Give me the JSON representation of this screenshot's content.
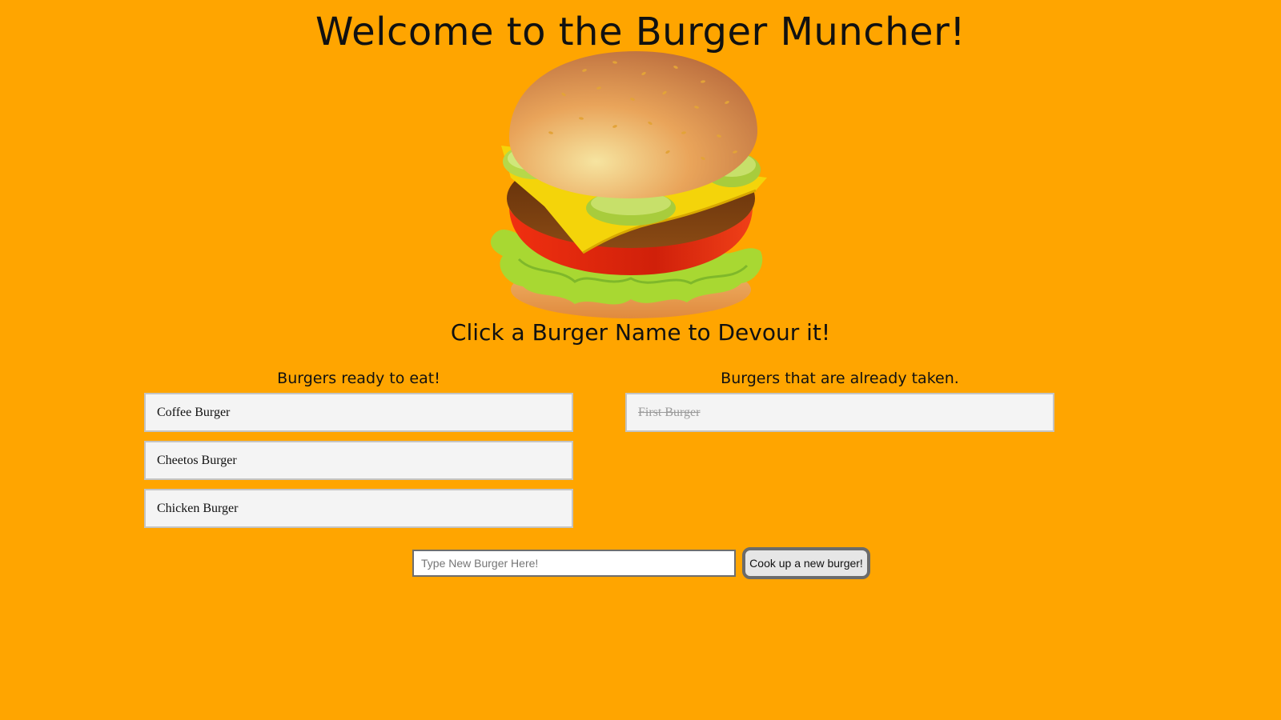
{
  "page": {
    "title": "Welcome to the Burger Muncher!",
    "subtitle": "Click a Burger Name to Devour it!",
    "background_color": "#FFA500"
  },
  "hero": {
    "image": "burger-illustration"
  },
  "ready_column": {
    "heading": "Burgers ready to eat!",
    "items": [
      "Coffee Burger",
      "Cheetos Burger",
      "Chicken Burger"
    ]
  },
  "devoured_column": {
    "heading": "Burgers that are already taken.",
    "items": [
      "First Burger"
    ]
  },
  "new_burger_form": {
    "placeholder": "Type New Burger Here!",
    "value": "",
    "button_label": "Cook up a new burger!"
  }
}
